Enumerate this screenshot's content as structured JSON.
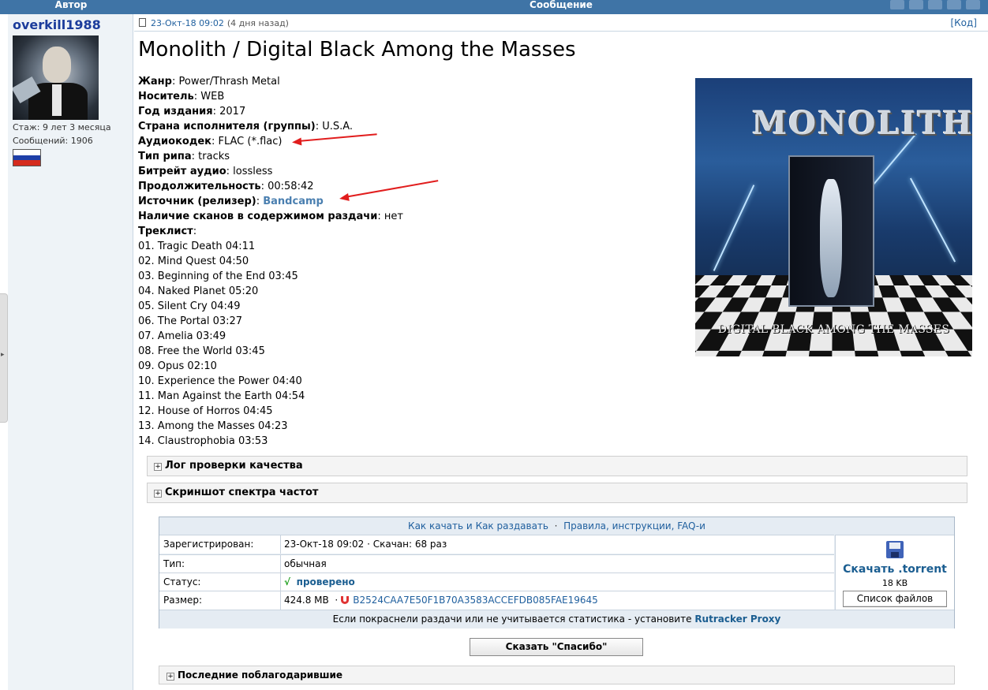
{
  "header": {
    "author_col": "Автор",
    "message_col": "Сообщение"
  },
  "author": {
    "username": "overkill1988",
    "tenure": "Стаж: 9 лет 3 месяца",
    "posts": "Сообщений: 1906",
    "flag_colors": [
      "#ffffff",
      "#1e3fa8",
      "#d52b1e"
    ]
  },
  "post": {
    "date": "23-Окт-18 09:02",
    "ago": "(4 дня назад)",
    "code_link": "[Код]",
    "title": "Monolith / Digital Black Among the Masses",
    "fields": [
      {
        "label": "Жанр",
        "value": ": Power/Thrash Metal"
      },
      {
        "label": "Носитель",
        "value": ": WEB"
      },
      {
        "label": "Год издания",
        "value": ": 2017"
      },
      {
        "label": "Страна исполнителя (группы)",
        "value": ": U.S.A."
      },
      {
        "label": "Аудиокодек",
        "value": ": FLAC (*.flac)"
      },
      {
        "label": "Тип рипа",
        "value": ": tracks"
      },
      {
        "label": "Битрейт аудио",
        "value": ": lossless"
      },
      {
        "label": "Продолжительность",
        "value": ": 00:58:42"
      },
      {
        "label": "Источник (релизер)",
        "value": ": ",
        "link": "Bandcamp"
      },
      {
        "label": "Наличие сканов в содержимом раздачи",
        "value": ": нет"
      },
      {
        "label": "Треклист",
        "value": ":"
      }
    ],
    "tracks": [
      "01. Tragic Death 04:11",
      "02. Mind Quest 04:50",
      "03. Beginning of the End 03:45",
      "04. Naked Planet 05:20",
      "05. Silent Cry 04:49",
      "06. The Portal 03:27",
      "07. Amelia 03:49",
      "08. Free the World 03:45",
      "09. Opus 02:10",
      "10. Experience the Power 04:40",
      "11. Man Against the Earth 04:54",
      "12. House of Horros 04:45",
      "13. Among the Masses 04:23",
      "14. Claustrophobia 03:53"
    ],
    "cover": {
      "logo": "MONOLITH",
      "tagline": "DIGITAL BLACK AMONG THE MASSES"
    },
    "annotation_arrow_color": "#e11d1d"
  },
  "spoilers": [
    "Лог проверки качества",
    "Скриншот спектра частот"
  ],
  "torrent": {
    "links": {
      "how_download": "Как качать",
      "and": "и",
      "how_seed": "Как раздавать",
      "sep": "·",
      "rules": "Правила, инструкции, FAQ-и"
    },
    "rows": {
      "registered_label": "Зарегистрирован:",
      "registered_value": "23-Окт-18 09:02 · Скачан: 68 раз",
      "type_label": "Тип:",
      "type_value": "обычная",
      "status_label": "Статус:",
      "status_check": "√",
      "status_value": "проверено",
      "size_label": "Размер:",
      "size_value": "424.8 MB",
      "size_sep": "·",
      "hash": "B2524CAA7E50F1B70A3583ACCEFDB085FAE19645"
    },
    "download": {
      "label": "Скачать .torrent",
      "size": "18 KB",
      "files_button": "Список файлов"
    },
    "proxy_notice": "Если покраснели раздачи или не учитывается статистика - установите",
    "proxy_link": "Rutracker Proxy"
  },
  "thanks_button": "Сказать \"Спасибо\"",
  "last_thanks": "Последние поблагодарившие"
}
